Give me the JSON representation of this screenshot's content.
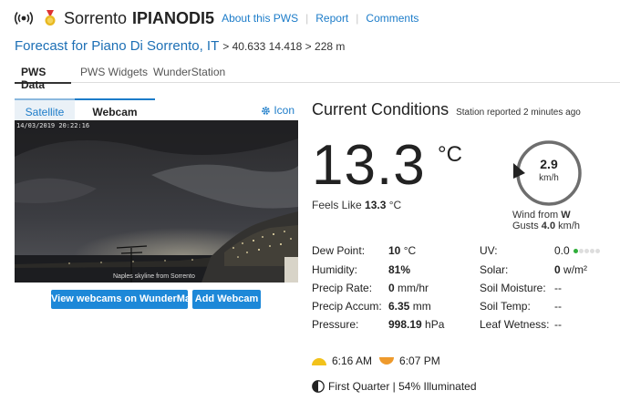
{
  "header": {
    "station_name": "Sorrento",
    "station_id": "IPIANODI5",
    "links": [
      "About this PWS",
      "Report",
      "Comments"
    ]
  },
  "forecast": {
    "title": "Forecast for Piano Di Sorrento, IT",
    "coords": "> 40.633 14.418 > 228 m"
  },
  "tabs": [
    "PWS Data",
    "PWS Widgets",
    "WunderStation"
  ],
  "camera": {
    "tab_satellite": "Satellite",
    "tab_webcam": "Webcam",
    "icon_label": "Icon",
    "timestamp": "14/03/2019 20:22:16",
    "caption": "Naples skyline from Sorrento",
    "btn_view": "View webcams on WunderMap",
    "btn_add": "Add Webcam"
  },
  "conditions": {
    "title": "Current Conditions",
    "reported": "Station reported 2 minutes ago",
    "temp": "13.3",
    "temp_unit": "°C",
    "feels_label": "Feels Like",
    "feels_value": "13.3",
    "feels_unit": "°C",
    "wind_speed": "2.9",
    "wind_unit": "km/h",
    "wind_from_label": "Wind from",
    "wind_from_value": "W",
    "gusts_label": "Gusts",
    "gusts_value": "4.0",
    "gusts_unit": "km/h",
    "left": {
      "dew_label": "Dew Point:",
      "dew_value": "10",
      "dew_unit": "°C",
      "hum_label": "Humidity:",
      "hum_value": "81%",
      "rate_label": "Precip Rate:",
      "rate_value": "0",
      "rate_unit": "mm/hr",
      "accum_label": "Precip Accum:",
      "accum_value": "6.35",
      "accum_unit": "mm",
      "press_label": "Pressure:",
      "press_value": "998.19",
      "press_unit": "hPa"
    },
    "right": {
      "uv_label": "UV:",
      "uv_value": "0.0",
      "solar_label": "Solar:",
      "solar_value": "0",
      "solar_unit": "w/m²",
      "moist_label": "Soil Moisture:",
      "moist_value": "--",
      "soilt_label": "Soil Temp:",
      "soilt_value": "--",
      "leaf_label": "Leaf Wetness:",
      "leaf_value": "--"
    },
    "sunrise": "6:16 AM",
    "sunset": "6:07 PM",
    "moon": "First Quarter | 54% Illuminated"
  },
  "colors": {
    "link": "#1c7cc9",
    "button": "#1d88d8",
    "sunrise": "#f2c21b",
    "sunset": "#ee9a2c",
    "uv_green": "#2fae3a"
  }
}
